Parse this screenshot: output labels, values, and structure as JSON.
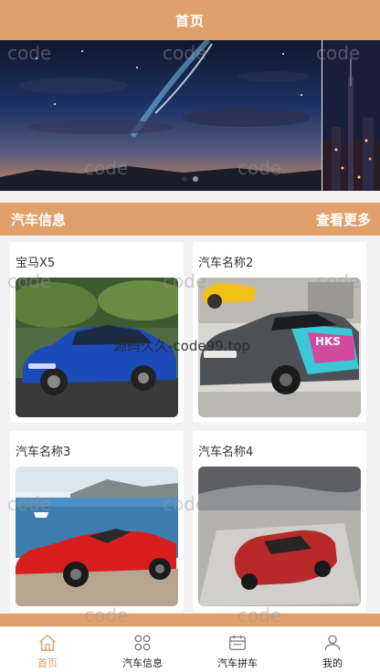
{
  "header": {
    "title": "首页"
  },
  "banner": {
    "slide_count": 2,
    "active_index": 0
  },
  "section": {
    "title": "汽车信息",
    "more_label": "查看更多"
  },
  "cars": [
    {
      "name": "宝马X5",
      "image": "blue-sports-coupe-photo"
    },
    {
      "name": "汽车名称2",
      "image": "wrapped-race-car-photo"
    },
    {
      "name": "汽车名称3",
      "image": "red-convertible-coast-photo"
    },
    {
      "name": "汽车名称4",
      "image": "red-coupe-aerial-photo"
    }
  ],
  "watermarks": {
    "code": "code",
    "site": "源码久久-code99.top"
  },
  "tabbar": {
    "active": "home",
    "items": [
      {
        "key": "home",
        "label": "首页",
        "icon": "home-icon"
      },
      {
        "key": "cars",
        "label": "汽车信息",
        "icon": "grid-icon"
      },
      {
        "key": "carpool",
        "label": "汽车拼车",
        "icon": "calendar-icon"
      },
      {
        "key": "mine",
        "label": "我的",
        "icon": "user-icon"
      }
    ]
  },
  "colors": {
    "accent": "#e1a06a",
    "background": "#f2f2f2"
  }
}
